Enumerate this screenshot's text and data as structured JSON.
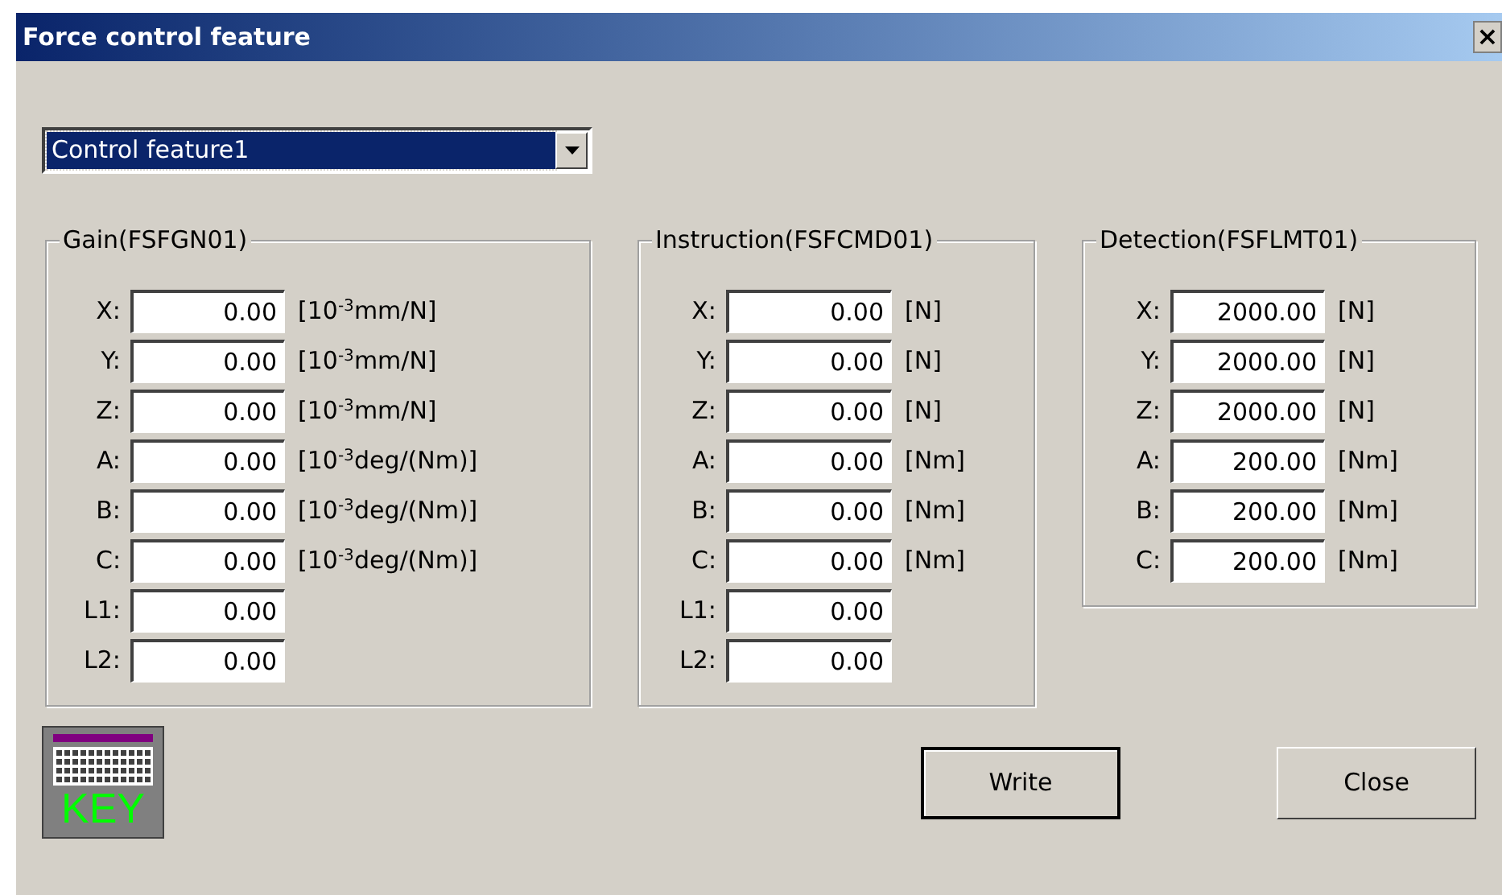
{
  "window": {
    "title": "Force control feature",
    "close_glyph": "×"
  },
  "selector": {
    "value": "Control feature1"
  },
  "groups": [
    {
      "title": "Gain(FSFGN01)",
      "rows": [
        {
          "label": "X:",
          "value": "0.00",
          "unit": "[10$^{-3}$mm/N]"
        },
        {
          "label": "Y:",
          "value": "0.00",
          "unit": "[10$^{-3}$mm/N]"
        },
        {
          "label": "Z:",
          "value": "0.00",
          "unit": "[10$^{-3}$mm/N]"
        },
        {
          "label": "A:",
          "value": "0.00",
          "unit": "[10$^{-3}$deg/(Nm)]"
        },
        {
          "label": "B:",
          "value": "0.00",
          "unit": "[10$^{-3}$deg/(Nm)]"
        },
        {
          "label": "C:",
          "value": "0.00",
          "unit": "[10$^{-3}$deg/(Nm)]"
        },
        {
          "label": "L1:",
          "value": "0.00"
        },
        {
          "label": "L2:",
          "value": "0.00"
        }
      ]
    },
    {
      "title": "Instruction(FSFCMD01)",
      "rows": [
        {
          "label": "X:",
          "value": "0.00",
          "unit": "[N]"
        },
        {
          "label": "Y:",
          "value": "0.00",
          "unit": "[N]"
        },
        {
          "label": "Z:",
          "value": "0.00",
          "unit": "[N]"
        },
        {
          "label": "A:",
          "value": "0.00",
          "unit": "[Nm]"
        },
        {
          "label": "B:",
          "value": "0.00",
          "unit": "[Nm]"
        },
        {
          "label": "C:",
          "value": "0.00",
          "unit": "[Nm]"
        },
        {
          "label": "L1:",
          "value": "0.00"
        },
        {
          "label": "L2:",
          "value": "0.00"
        }
      ]
    },
    {
      "title": "Detection(FSFLMT01)",
      "rows": [
        {
          "label": "X:",
          "value": "2000.00",
          "unit": "[N]"
        },
        {
          "label": "Y:",
          "value": "2000.00",
          "unit": "[N]"
        },
        {
          "label": "Z:",
          "value": "2000.00",
          "unit": "[N]"
        },
        {
          "label": "A:",
          "value": "200.00",
          "unit": "[Nm]"
        },
        {
          "label": "B:",
          "value": "200.00",
          "unit": "[Nm]"
        },
        {
          "label": "C:",
          "value": "200.00",
          "unit": "[Nm]"
        }
      ]
    }
  ],
  "key_button": {
    "label": "KEY"
  },
  "buttons": [
    {
      "label": "Write",
      "default": true
    },
    {
      "label": "Close",
      "default": false
    }
  ]
}
